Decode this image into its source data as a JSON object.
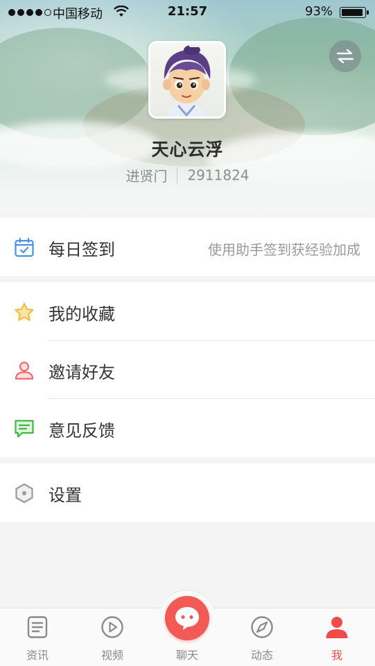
{
  "status_bar": {
    "carrier": "中国移动",
    "time": "21:57",
    "battery_percent": "93%",
    "battery_level": 0.93,
    "signal_bars_filled": 4,
    "signal_bars_total": 5
  },
  "profile": {
    "username": "天心云浮",
    "faction": "进贤门",
    "user_id": "2911824",
    "switch_icon": "swap-arrows-icon",
    "avatar_icon": "character-avatar"
  },
  "menu": {
    "daily_checkin": {
      "label": "每日签到",
      "hint": "使用助手签到获经验加成",
      "icon": "calendar-check-icon",
      "color": "#4a90e2"
    },
    "favorites": {
      "label": "我的收藏",
      "icon": "star-icon",
      "color": "#f5b83d"
    },
    "invite": {
      "label": "邀请好友",
      "icon": "user-icon",
      "color": "#f26b6b"
    },
    "feedback": {
      "label": "意见反馈",
      "icon": "message-icon",
      "color": "#3cba3c"
    },
    "settings": {
      "label": "设置",
      "icon": "hexagon-gear-icon",
      "color": "#9a9a9a"
    }
  },
  "tabbar": {
    "tabs": [
      {
        "label": "资讯",
        "icon": "news-icon"
      },
      {
        "label": "视频",
        "icon": "play-icon"
      },
      {
        "label": "聊天",
        "icon": "chat-icon"
      },
      {
        "label": "动态",
        "icon": "compass-icon"
      },
      {
        "label": "我",
        "icon": "person-icon",
        "active": true
      }
    ],
    "active_color": "#f04a4a",
    "inactive_color": "#8a8a8a"
  }
}
